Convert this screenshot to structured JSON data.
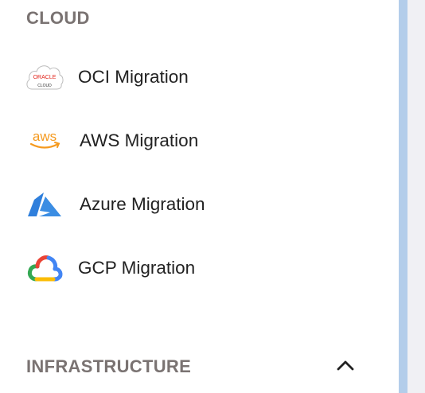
{
  "sections": {
    "cloud": {
      "title": "CLOUD",
      "items": [
        {
          "label": "OCI Migration",
          "icon": "oracle-cloud-icon",
          "logo_text_top": "ORACLE",
          "logo_text_bottom": "CLOUD"
        },
        {
          "label": "AWS Migration",
          "icon": "aws-icon",
          "logo_text": "aws"
        },
        {
          "label": "Azure Migration",
          "icon": "azure-icon"
        },
        {
          "label": "GCP Migration",
          "icon": "gcp-icon"
        }
      ]
    },
    "infrastructure": {
      "title": "INFRASTRUCTURE",
      "expanded": true,
      "toggle_icon": "chevron-up-icon"
    }
  },
  "colors": {
    "heading": "#7a7372",
    "label": "#222222",
    "accent_bar": "#b3cdea",
    "oracle_red": "#e2231a",
    "aws_orange": "#f59a1f",
    "azure_blue": "#2f7fdc"
  }
}
